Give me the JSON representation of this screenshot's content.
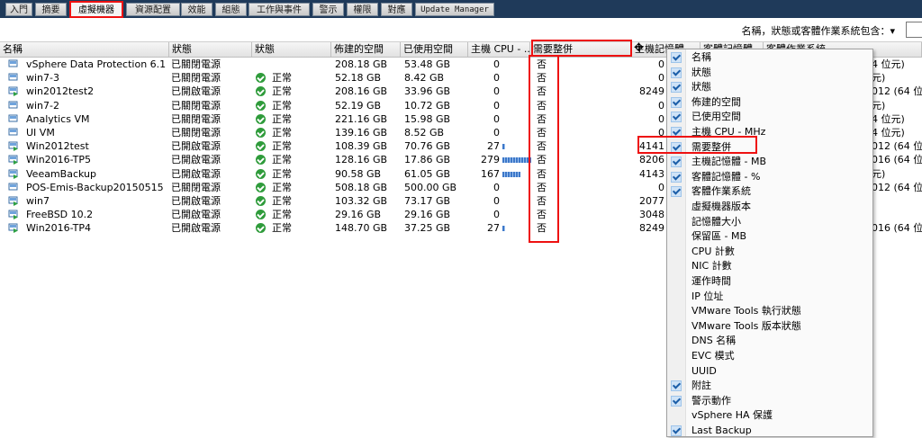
{
  "tabs": [
    {
      "label": "入門"
    },
    {
      "label": "摘要"
    },
    {
      "label": "虛擬機器"
    },
    {
      "label": "資源配置"
    },
    {
      "label": "效能"
    },
    {
      "label": "組態"
    },
    {
      "label": "工作與事件"
    },
    {
      "label": "警示"
    },
    {
      "label": "權限"
    },
    {
      "label": "對應"
    },
    {
      "label": "Update Manager"
    }
  ],
  "active_tab": "虛擬機器",
  "filter": {
    "label": "名稱，狀態或客體作業系統包含：▾",
    "value": ""
  },
  "columns": [
    "名稱",
    "狀態",
    "狀態",
    "佈建的空間",
    "已使用空間",
    "主機 CPU - ...",
    "需要整併",
    "主機記憶體",
    "客體記憶體",
    "客體作業系統"
  ],
  "rows": [
    {
      "name": "vSphere Data Protection 6.1",
      "power": "已關閉電源",
      "status": "",
      "prov": "208.18 GB",
      "used": "53.48 GB",
      "cpu": "0",
      "cpu_bar": 0,
      "cons": "否",
      "mem": "0",
      "guest": "4 位元)"
    },
    {
      "name": "win7-3",
      "power": "已關閉電源",
      "status": "正常",
      "prov": "52.18 GB",
      "used": "8.42 GB",
      "cpu": "0",
      "cpu_bar": 0,
      "cons": "否",
      "mem": "0",
      "guest": "元)"
    },
    {
      "name": "win2012test2",
      "power": "已開啟電源",
      "status": "正常",
      "prov": "208.16 GB",
      "used": "33.96 GB",
      "cpu": "0",
      "cpu_bar": 0,
      "cons": "否",
      "mem": "8249",
      "guest": "012 (64 位"
    },
    {
      "name": "win7-2",
      "power": "已關閉電源",
      "status": "正常",
      "prov": "52.19 GB",
      "used": "10.72 GB",
      "cpu": "0",
      "cpu_bar": 0,
      "cons": "否",
      "mem": "0",
      "guest": "元)"
    },
    {
      "name": "Analytics VM",
      "power": "已關閉電源",
      "status": "正常",
      "prov": "221.16 GB",
      "used": "15.98 GB",
      "cpu": "0",
      "cpu_bar": 0,
      "cons": "否",
      "mem": "0",
      "guest": "4 位元)"
    },
    {
      "name": "UI VM",
      "power": "已關閉電源",
      "status": "正常",
      "prov": "139.16 GB",
      "used": "8.52 GB",
      "cpu": "0",
      "cpu_bar": 0,
      "cons": "否",
      "mem": "0",
      "guest": "4 位元)"
    },
    {
      "name": "Win2012test",
      "power": "已開啟電源",
      "status": "正常",
      "prov": "108.39 GB",
      "used": "70.76 GB",
      "cpu": "27",
      "cpu_bar": 0.1,
      "cons": "否",
      "mem": "4141",
      "guest": "012 (64 位"
    },
    {
      "name": "Win2016-TP5",
      "power": "已開啟電源",
      "status": "正常",
      "prov": "128.16 GB",
      "used": "17.86 GB",
      "cpu": "279",
      "cpu_bar": 0.95,
      "cons": "否",
      "mem": "8206",
      "guest": "016 (64 位"
    },
    {
      "name": "VeeamBackup",
      "power": "已開啟電源",
      "status": "正常",
      "prov": "90.58 GB",
      "used": "61.05 GB",
      "cpu": "167",
      "cpu_bar": 0.6,
      "cons": "否",
      "mem": "4143",
      "guest": "元)"
    },
    {
      "name": "POS-Emis-Backup20150515",
      "power": "已關閉電源",
      "status": "正常",
      "prov": "508.18 GB",
      "used": "500.00 GB",
      "cpu": "0",
      "cpu_bar": 0,
      "cons": "否",
      "mem": "0",
      "guest": "012 (64 位"
    },
    {
      "name": "win7",
      "power": "已開啟電源",
      "status": "正常",
      "prov": "103.32 GB",
      "used": "73.17 GB",
      "cpu": "0",
      "cpu_bar": 0,
      "cons": "否",
      "mem": "2077",
      "guest": ""
    },
    {
      "name": "FreeBSD 10.2",
      "power": "已開啟電源",
      "status": "正常",
      "prov": "29.16 GB",
      "used": "29.16 GB",
      "cpu": "0",
      "cpu_bar": 0,
      "cons": "否",
      "mem": "3048",
      "guest": ""
    },
    {
      "name": "Win2016-TP4",
      "power": "已開啟電源",
      "status": "正常",
      "prov": "148.70 GB",
      "used": "37.25 GB",
      "cpu": "27",
      "cpu_bar": 0.1,
      "cons": "否",
      "mem": "8249",
      "guest": "016 (64 位"
    }
  ],
  "menu": [
    {
      "label": "名稱",
      "checked": true
    },
    {
      "label": "狀態",
      "checked": true
    },
    {
      "label": "狀態",
      "checked": true
    },
    {
      "label": "佈建的空間",
      "checked": true
    },
    {
      "label": "已使用空間",
      "checked": true
    },
    {
      "label": "主機 CPU - MHz",
      "checked": true
    },
    {
      "label": "需要整併",
      "checked": true
    },
    {
      "label": "主機記憶體 - MB",
      "checked": true
    },
    {
      "label": "客體記憶體 - %",
      "checked": true
    },
    {
      "label": "客體作業系統",
      "checked": true
    },
    {
      "label": "虛擬機器版本",
      "checked": false
    },
    {
      "label": "記憶體大小",
      "checked": false
    },
    {
      "label": "保留區 - MB",
      "checked": false
    },
    {
      "label": "CPU 計數",
      "checked": false
    },
    {
      "label": "NIC 計數",
      "checked": false
    },
    {
      "label": "運作時間",
      "checked": false
    },
    {
      "label": "IP 位址",
      "checked": false
    },
    {
      "label": "VMware Tools 執行狀態",
      "checked": false
    },
    {
      "label": "VMware Tools 版本狀態",
      "checked": false
    },
    {
      "label": "DNS 名稱",
      "checked": false
    },
    {
      "label": "EVC 模式",
      "checked": false
    },
    {
      "label": "UUID",
      "checked": false
    },
    {
      "label": "附註",
      "checked": true
    },
    {
      "label": "警示動作",
      "checked": true
    },
    {
      "label": "vSphere HA 保護",
      "checked": false
    },
    {
      "label": "Last Backup",
      "checked": true
    }
  ]
}
